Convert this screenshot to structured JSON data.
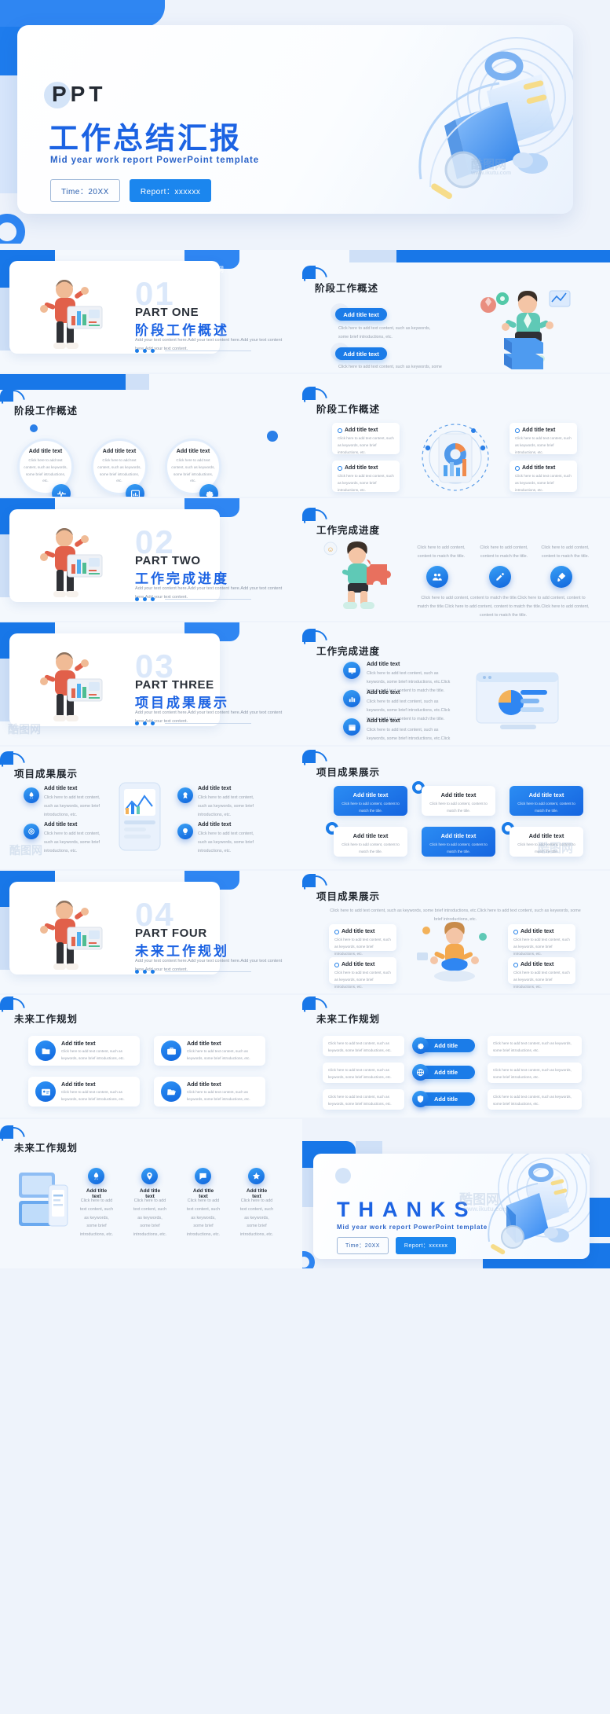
{
  "meta": {
    "watermark": "酷图网",
    "watermark_url": "www.ikutu.com"
  },
  "cover": {
    "eyebrow": "PPT",
    "title": "工作总结汇报",
    "subtitle": "Mid year work report PowerPoint template",
    "btn_time": "Time：20XX",
    "btn_report": "Report：xxxxxx"
  },
  "parts": [
    {
      "num": "01",
      "en": "PART ONE",
      "cn": "阶段工作概述",
      "desc": "Add your text content here.Add your text content here.Add your text content here.Add your text content."
    },
    {
      "num": "02",
      "en": "PART TWO",
      "cn": "工作完成进度",
      "desc": "Add your text content here.Add your text content here.Add your text content here.Add your text content."
    },
    {
      "num": "03",
      "en": "PART THREE",
      "cn": "项目成果展示",
      "desc": "Add your text content here.Add your text content here.Add your text content here.Add your text content."
    },
    {
      "num": "04",
      "en": "PART FOUR",
      "cn": "未来工作规划",
      "desc": "Add your text content here.Add your text content here.Add your text content here.Add your text content."
    }
  ],
  "section_titles": {
    "overview": "阶段工作概述",
    "progress": "工作完成进度",
    "results": "项目成果展示",
    "future": "未来工作规划"
  },
  "common": {
    "add_title": "Add title text",
    "add_title_short": "Add title",
    "body_a": "Click here to add text content, such as keywords, some brief introductions, etc.",
    "body_b": "Click here to add text content, such as keywords, some brief introductions, etc.",
    "body_c": "Click here to add content, content to match the title.",
    "body_d": "Click here to add content, content to match the title.Click here to add content, content to match the title."
  },
  "slide_overview_a": {
    "title": "阶段工作概述",
    "items": [
      {
        "pill": "Add title text",
        "text": "Click here to add text content, such as keywords, some brief introductions, etc."
      },
      {
        "pill": "Add title text",
        "text": "Click here to add text content, such as keywords, some brief introductions, etc."
      }
    ]
  },
  "slide_overview_circles": {
    "title": "阶段工作概述",
    "items": [
      {
        "title": "Add title text",
        "text": "Click here to add text content, such as keywords, some brief introductions, etc.",
        "icon": "wave-icon"
      },
      {
        "title": "Add title text",
        "text": "Click here to add text content, such as keywords, some brief introductions, etc.",
        "icon": "chart-icon"
      },
      {
        "title": "Add title text",
        "text": "Click here to add text content, such as keywords, some brief introductions, etc.",
        "icon": "gear-icon"
      }
    ]
  },
  "slide_overview_donut": {
    "title": "阶段工作概述",
    "items": [
      {
        "title": "Add title text",
        "text": "Click here to add text content, such as keywords, some brief introductions, etc."
      },
      {
        "title": "Add title text",
        "text": "Click here to add text content, such as keywords, some brief introductions, etc."
      },
      {
        "title": "Add title text",
        "text": "Click here to add text content, such as keywords, some brief introductions, etc."
      },
      {
        "title": "Add title text",
        "text": "Click here to add text content, such as keywords, some brief introductions, etc."
      }
    ]
  },
  "slide_progress_puzzle": {
    "title": "工作完成进度",
    "columns": [
      {
        "text": "Click here to add content, content to match the title.",
        "icon": "people-icon"
      },
      {
        "text": "Click here to add content, content to match the title.",
        "icon": "pen-icon"
      },
      {
        "text": "Click here to add content, content to match the title.",
        "icon": "brush-icon"
      }
    ],
    "footer": "Click here to add content, content to match the title.Click here to add content, content to match the title.Click here to add content, content to match the title.Click here to add content, content to match the title."
  },
  "slide_progress_list": {
    "title": "工作完成进度",
    "items": [
      {
        "title": "Add title text",
        "text": "Click here to add text content, such as keywords, some brief introductions, etc.Click here to add text content to match the title.",
        "icon": "monitor-icon"
      },
      {
        "title": "Add title text",
        "text": "Click here to add text content, such as keywords, some brief introductions, etc.Click here to add text content to match the title.",
        "icon": "chart-bar-icon"
      },
      {
        "title": "Add title text",
        "text": "Click here to add text content, such as keywords, some brief introductions, etc.Click here to add text content to match the title.",
        "icon": "calendar-icon"
      }
    ]
  },
  "slide_results_icons": {
    "title": "项目成果展示",
    "items": [
      {
        "title": "Add title text",
        "text": "Click here to add text content, such as keywords, some brief introductions, etc.",
        "icon": "rocket-icon"
      },
      {
        "title": "Add title text",
        "text": "Click here to add text content, such as keywords, some brief introductions, etc.",
        "icon": "target-icon"
      },
      {
        "title": "Add title text",
        "text": "Click here to add text content, such as keywords, some brief introductions, etc.",
        "icon": "badge-icon"
      },
      {
        "title": "Add title text",
        "text": "Click here to add text content, such as keywords, some brief introductions, etc.",
        "icon": "lightbulb-icon"
      }
    ]
  },
  "slide_results_grid": {
    "title": "项目成果展示",
    "cells": [
      {
        "title": "Add title text",
        "text": "Click here to add content, content to match the title.",
        "style": "blue"
      },
      {
        "title": "Add title text",
        "text": "Click here to add content, content to match the title.",
        "style": "white"
      },
      {
        "title": "Add title text",
        "text": "Click here to add content, content to match the title.",
        "style": "blue"
      },
      {
        "title": "Add title text",
        "text": "Click here to add content, content to match the title.",
        "style": "white"
      },
      {
        "title": "Add title text",
        "text": "Click here to add content, content to match the title.",
        "style": "blue"
      },
      {
        "title": "Add title text",
        "text": "Click here to add content, content to match the title.",
        "style": "white"
      }
    ]
  },
  "slide_results_people": {
    "title": "项目成果展示",
    "intro": "Click here to add text content, such as keywords, some brief introductions, etc.Click here to add text content, such as keywords, some brief introductions, etc.",
    "items": [
      {
        "title": "Add title text",
        "text": "Click here to add text content, such as keywords, some brief introductions, etc."
      },
      {
        "title": "Add title text",
        "text": "Click here to add text content, such as keywords, some brief introductions, etc."
      },
      {
        "title": "Add title text",
        "text": "Click here to add text content, such as keywords, some brief introductions, etc."
      },
      {
        "title": "Add title text",
        "text": "Click here to add text content, such as keywords, some brief introductions, etc."
      }
    ]
  },
  "slide_future_cards": {
    "title": "未来工作规划",
    "items": [
      {
        "title": "Add title text",
        "text": "Click here to add text content, such as keywords, some brief introductions, etc.",
        "icon": "folder-icon"
      },
      {
        "title": "Add title text",
        "text": "Click here to add text content, such as keywords, some brief introductions, etc.",
        "icon": "briefcase-icon"
      },
      {
        "title": "Add title text",
        "text": "Click here to add text content, such as keywords, some brief introductions, etc.",
        "icon": "id-card-icon"
      },
      {
        "title": "Add title text",
        "text": "Click here to add text content, such as keywords, some brief introductions, etc.",
        "icon": "folder-open-icon"
      }
    ]
  },
  "slide_future_mid": {
    "title": "未来工作规划",
    "left": [
      "Click here to add text content, such as keywords, some brief introductions, etc.",
      "Click here to add text content, such as keywords, some brief introductions, etc.",
      "Click here to add text content, such as keywords, some brief introductions, etc."
    ],
    "center": [
      {
        "label": "Add title",
        "icon": "gear-icon"
      },
      {
        "label": "Add title",
        "icon": "globe-icon"
      },
      {
        "label": "Add title",
        "icon": "shield-icon"
      }
    ],
    "right": [
      "Click here to add text content, such as keywords, some brief introductions, etc.",
      "Click here to add text content, such as keywords, some brief introductions, etc.",
      "Click here to add text content, such as keywords, some brief introductions, etc."
    ]
  },
  "slide_future_last": {
    "title": "未来工作规划",
    "items": [
      {
        "title": "Add title text",
        "text": "Click here to add text content, such as keywords, some brief introductions, etc.",
        "icon": "rocket-icon"
      },
      {
        "title": "Add title text",
        "text": "Click here to add text content, such as keywords, some brief introductions, etc.",
        "icon": "pin-icon"
      },
      {
        "title": "Add title text",
        "text": "Click here to add text content, such as keywords, some brief introductions, etc.",
        "icon": "chat-icon"
      },
      {
        "title": "Add title text",
        "text": "Click here to add text content, such as keywords, some brief introductions, etc.",
        "icon": "star-icon"
      }
    ]
  },
  "thanks": {
    "title": "THANKS",
    "subtitle": "Mid year work report PowerPoint template",
    "btn_time": "Time：20XX",
    "btn_report": "Report：xxxxxx"
  },
  "colors": {
    "primary": "#1b7ce8",
    "deep": "#1c63e3",
    "page_bg": "#eef3fb",
    "slide_bg": "#f4f8fd",
    "text_dark": "#242a33",
    "text_muted": "#9aa3b0"
  }
}
